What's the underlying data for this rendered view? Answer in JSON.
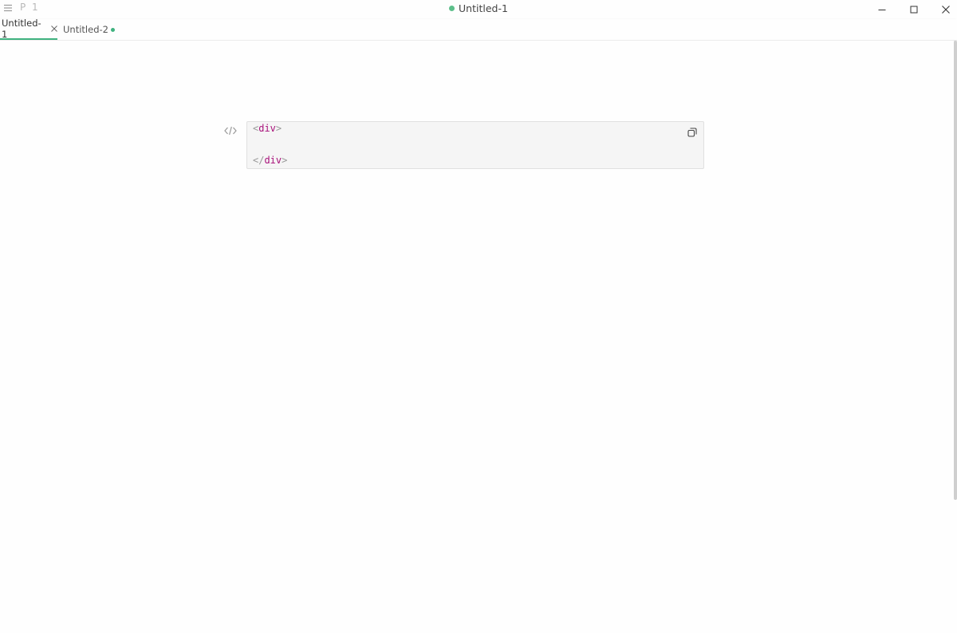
{
  "titlebar": {
    "paragraph_indicator": "P 1",
    "title": "Untitled-1",
    "icons": {
      "menu": "hamburger-menu-icon",
      "minimize": "minimize-icon",
      "maximize": "maximize-icon",
      "close": "close-icon"
    }
  },
  "tabs": [
    {
      "label": "Untitled-1",
      "active": true,
      "saved": true
    },
    {
      "label": "Untitled-2",
      "active": false,
      "saved": false
    }
  ],
  "colors": {
    "accent": "#3fb27f",
    "title_dot": "#5cbf8a",
    "tag": "#a8117a",
    "punctuation": "#999999"
  },
  "code_block": {
    "language_icon": "code-icon",
    "copy_icon": "copy-icon",
    "lines": [
      {
        "open": "<",
        "tag": "div",
        "close": ">"
      },
      {
        "open": "",
        "tag": "",
        "close": ""
      },
      {
        "open": "</",
        "tag": "div",
        "close": ">"
      }
    ]
  }
}
